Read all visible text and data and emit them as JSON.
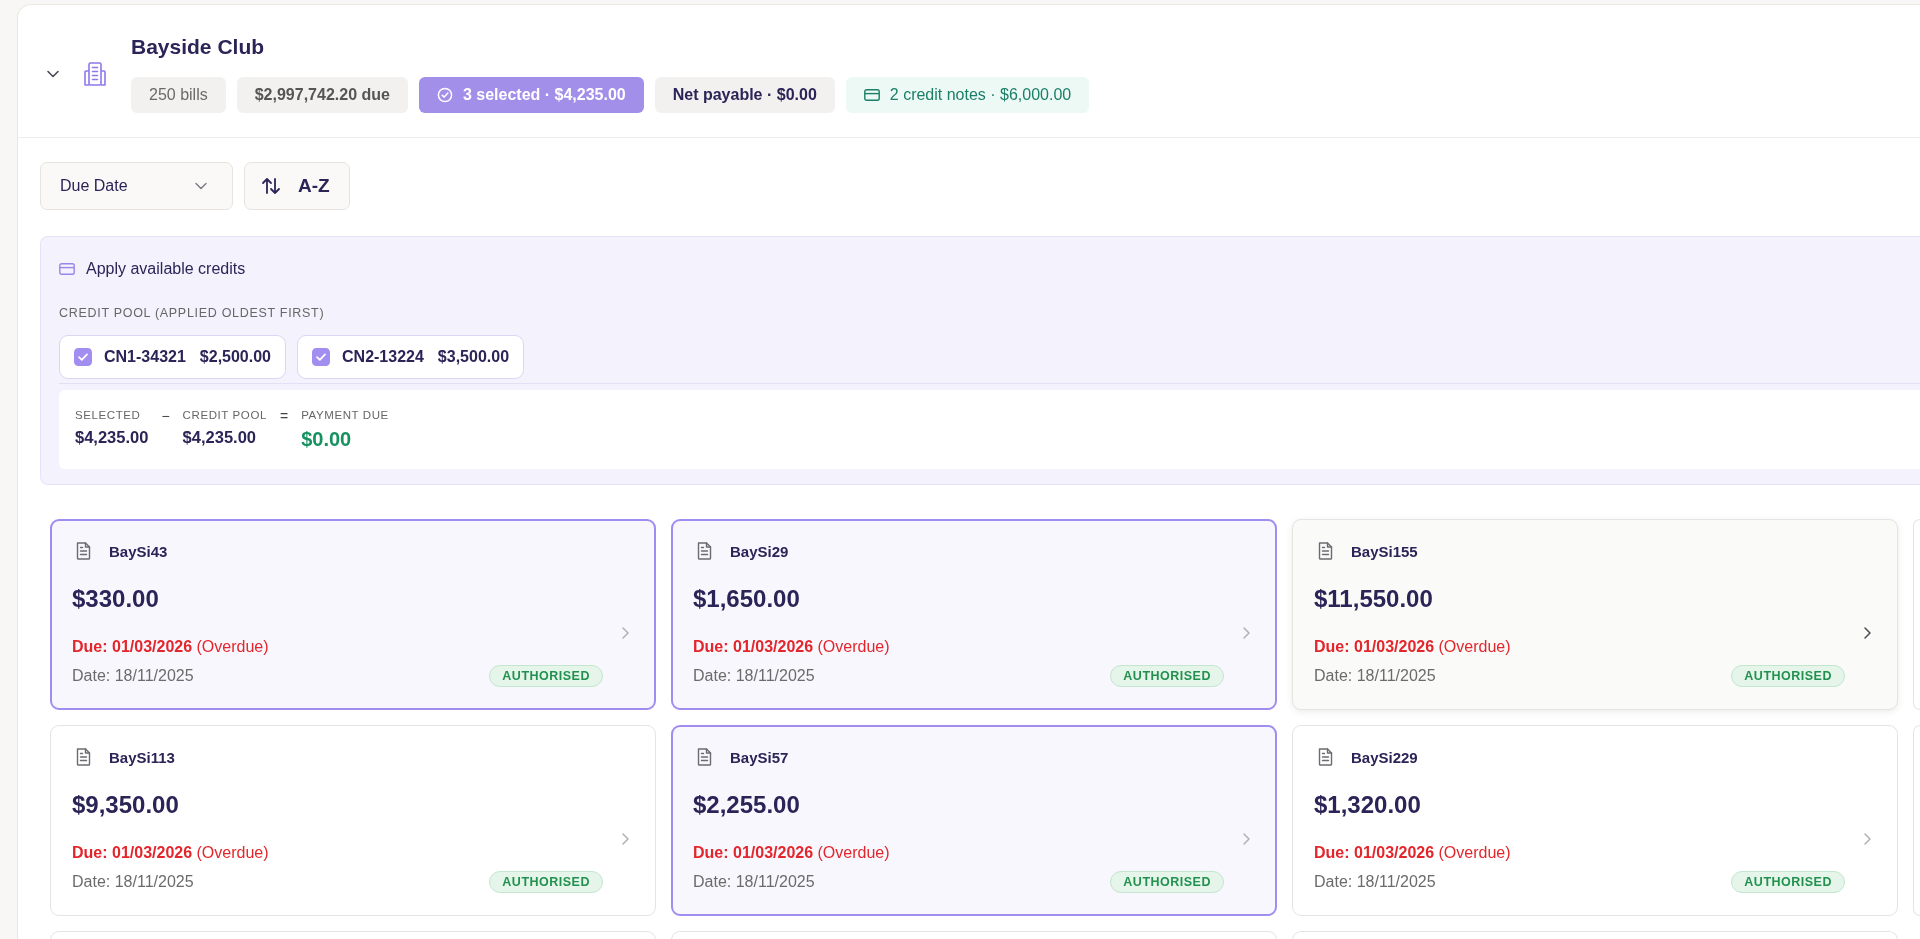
{
  "group": {
    "name": "Bayside Club",
    "expanded": true,
    "badges": [
      {
        "kind": "plain",
        "text": "250 bills"
      },
      {
        "kind": "strong",
        "text": "$2,997,742.20 due"
      },
      {
        "kind": "selected",
        "text": "3 selected · $4,235.00"
      },
      {
        "kind": "net",
        "text": "Net payable · $0.00"
      },
      {
        "kind": "credit",
        "text": "2 credit notes · $6,000.00"
      }
    ]
  },
  "toolbar": {
    "sort_field": "Due Date",
    "sort_order": "A-Z"
  },
  "credits": {
    "title": "Apply available credits",
    "pool_label": "CREDIT POOL (APPLIED OLDEST FIRST)",
    "notes": [
      {
        "id": "CN1-34321",
        "amount": "$2,500.00",
        "checked": true
      },
      {
        "id": "CN2-13224",
        "amount": "$3,500.00",
        "checked": true
      }
    ],
    "summary": [
      {
        "kind": "term",
        "label": "SELECTED",
        "value": "$4,235.00"
      },
      {
        "kind": "operator",
        "symbol": "−"
      },
      {
        "kind": "term",
        "label": "CREDIT POOL",
        "value": "$4,235.00"
      },
      {
        "kind": "operator",
        "symbol": "="
      },
      {
        "kind": "result",
        "label": "PAYMENT DUE",
        "value": "$0.00"
      }
    ]
  },
  "bills": [
    {
      "id": "BaySi43",
      "amount": "$330.00",
      "due": "**Due: 01/03/2026** (Overdue)",
      "date": "Date: 18/11/2025",
      "status": "AUTHORISED",
      "selected": true,
      "hovered": false
    },
    {
      "id": "BaySi29",
      "amount": "$1,650.00",
      "due": "**Due: 01/03/2026** (Overdue)",
      "date": "Date: 18/11/2025",
      "status": "AUTHORISED",
      "selected": true,
      "hovered": false
    },
    {
      "id": "BaySi155",
      "amount": "$11,550.00",
      "due": "**Due: 01/03/2026** (Overdue)",
      "date": "Date: 18/11/2025",
      "status": "AUTHORISED",
      "selected": false,
      "hovered": true
    },
    {
      "id": "BaySi113",
      "amount": "$9,350.00",
      "due": "**Due: 01/03/2026** (Overdue)",
      "date": "Date: 18/11/2025",
      "status": "AUTHORISED",
      "selected": false,
      "hovered": false
    },
    {
      "id": "BaySi57",
      "amount": "$2,255.00",
      "due": "**Due: 01/03/2026** (Overdue)",
      "date": "Date: 18/11/2025",
      "status": "AUTHORISED",
      "selected": true,
      "hovered": false
    },
    {
      "id": "BaySi229",
      "amount": "$1,320.00",
      "due": "**Due: 01/03/2026** (Overdue)",
      "date": "Date: 18/11/2025",
      "status": "AUTHORISED",
      "selected": false,
      "hovered": false
    }
  ]
}
